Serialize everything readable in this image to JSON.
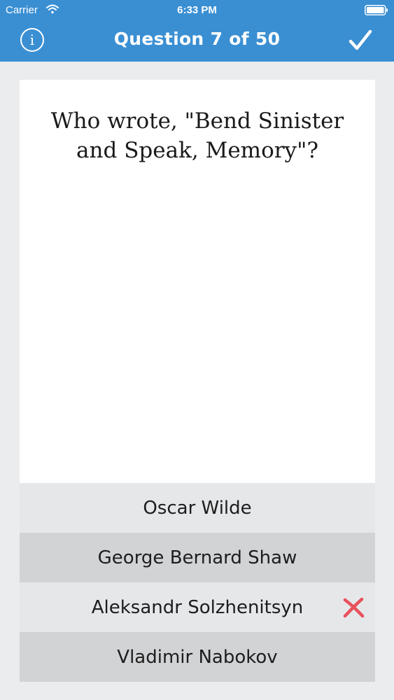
{
  "status_bar": {
    "carrier": "Carrier",
    "time": "6:33 PM"
  },
  "nav": {
    "title": "Question 7 of 50",
    "info_icon": "info-icon",
    "confirm_icon": "checkmark-icon"
  },
  "question": {
    "text": "Who wrote, \"Bend Sinister and Speak, Memory\"?"
  },
  "answers": [
    {
      "label": "Oscar Wilde",
      "state": "default"
    },
    {
      "label": "George Bernard Shaw",
      "state": "default"
    },
    {
      "label": "Aleksandr Solzhenitsyn",
      "state": "wrong"
    },
    {
      "label": "Vladimir Nabokov",
      "state": "default"
    }
  ],
  "colors": {
    "header_blue": "#3a8fd3",
    "background": "#ebecee",
    "answer_light": "#e6e7e9",
    "answer_dark": "#d2d3d5",
    "wrong_red": "#e8515a"
  }
}
